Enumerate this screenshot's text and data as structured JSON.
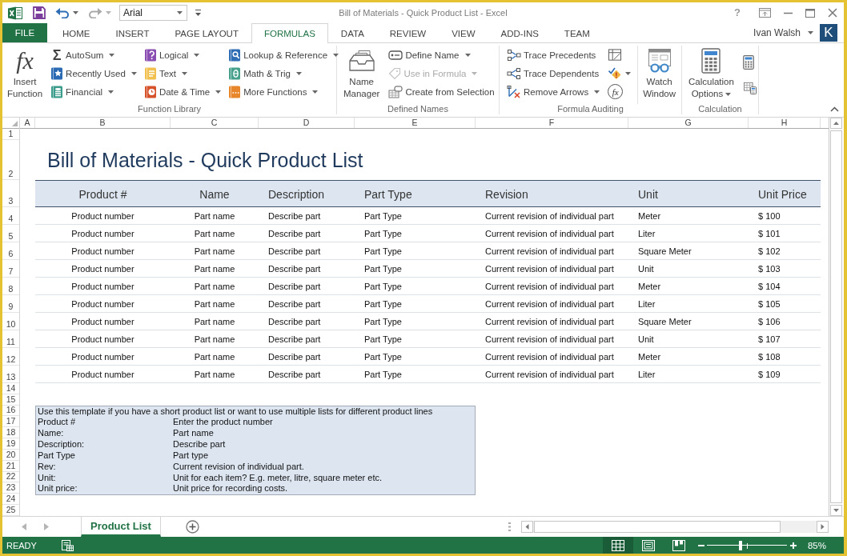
{
  "title_bar": {
    "font_name": "Arial",
    "title": "Bill of Materials - Quick Product List - Excel",
    "help": "?"
  },
  "ribbon_tabs": [
    {
      "label": "FILE",
      "kind": "file",
      "selected": false
    },
    {
      "label": "HOME",
      "kind": "tab",
      "selected": false
    },
    {
      "label": "INSERT",
      "kind": "tab",
      "selected": false
    },
    {
      "label": "PAGE LAYOUT",
      "kind": "tab",
      "selected": false
    },
    {
      "label": "FORMULAS",
      "kind": "tab",
      "selected": true
    },
    {
      "label": "DATA",
      "kind": "tab",
      "selected": false
    },
    {
      "label": "REVIEW",
      "kind": "tab",
      "selected": false
    },
    {
      "label": "VIEW",
      "kind": "tab",
      "selected": false
    },
    {
      "label": "ADD-INS",
      "kind": "tab",
      "selected": false
    },
    {
      "label": "TEAM",
      "kind": "tab",
      "selected": false
    }
  ],
  "account": {
    "user": "Ivan Walsh",
    "avatar": "K"
  },
  "ribbon_groups": [
    {
      "label": "Function Library",
      "columns": [
        [
          {
            "kind": "large",
            "glyph": "fx",
            "label": "Insert Function",
            "dropdown": false,
            "disabled": false
          }
        ],
        [
          {
            "kind": "small",
            "glyph": "Σ",
            "label": "AutoSum",
            "dropdown": true,
            "disabled": false
          },
          {
            "kind": "small",
            "label": "Recently Used",
            "dropdown": true,
            "disabled": false
          },
          {
            "kind": "small",
            "label": "Financial",
            "dropdown": true,
            "disabled": false
          }
        ],
        [
          {
            "kind": "small",
            "label": "Logical",
            "dropdown": true,
            "disabled": false
          },
          {
            "kind": "small",
            "label": "Text",
            "dropdown": true,
            "disabled": false
          },
          {
            "kind": "small",
            "label": "Date & Time",
            "dropdown": true,
            "disabled": false
          }
        ],
        [
          {
            "kind": "small",
            "label": "Lookup & Reference",
            "dropdown": true,
            "disabled": false
          },
          {
            "kind": "small",
            "label": "Math & Trig",
            "dropdown": true,
            "disabled": false
          },
          {
            "kind": "small",
            "label": "More Functions",
            "dropdown": true,
            "disabled": false
          }
        ]
      ]
    },
    {
      "label": "Defined Names",
      "columns": [
        [
          {
            "kind": "large",
            "label": "Name Manager",
            "dropdown": false,
            "disabled": false
          }
        ],
        [
          {
            "kind": "small",
            "label": "Define Name",
            "dropdown": true,
            "disabled": false
          },
          {
            "kind": "small",
            "label": "Use in Formula",
            "dropdown": true,
            "disabled": true
          },
          {
            "kind": "small",
            "label": "Create from Selection",
            "dropdown": false,
            "disabled": false
          }
        ]
      ]
    },
    {
      "label": "Formula Auditing",
      "columns": [
        [
          {
            "kind": "small",
            "label": "Trace Precedents",
            "dropdown": false,
            "disabled": false
          },
          {
            "kind": "small",
            "label": "Trace Dependents",
            "dropdown": false,
            "disabled": false
          },
          {
            "kind": "small",
            "label": "Remove Arrows",
            "dropdown": true,
            "disabled": false
          }
        ],
        [
          {
            "kind": "icon",
            "dropdown": false,
            "disabled": false
          },
          {
            "kind": "icon",
            "dropdown": true,
            "disabled": false
          },
          {
            "kind": "icon",
            "glyph": "fx",
            "dropdown": false,
            "disabled": false
          }
        ],
        [
          {
            "kind": "large",
            "label": "Watch Window",
            "dropdown": false,
            "disabled": false
          }
        ]
      ]
    },
    {
      "label": "Calculation",
      "columns": [
        [
          {
            "kind": "large",
            "label": "Calculation Options",
            "dropdown": true,
            "disabled": false
          }
        ],
        [
          {
            "kind": "icon",
            "dropdown": false,
            "disabled": false
          },
          {
            "kind": "icon",
            "dropdown": false,
            "disabled": false
          }
        ]
      ]
    }
  ],
  "sheet": {
    "column_headers": [
      "A",
      "B",
      "C",
      "D",
      "E",
      "F",
      "G",
      "H"
    ],
    "row_numbers": [
      "1",
      "2",
      "3",
      "4",
      "5",
      "6",
      "7",
      "8",
      "9",
      "10",
      "11",
      "12",
      "13",
      "14",
      "15",
      "16",
      "17",
      "18",
      "19",
      "20",
      "21",
      "22",
      "23",
      "24",
      "25"
    ],
    "title": "Bill of Materials - Quick Product List",
    "table": {
      "columns": [
        "Product #",
        "Name",
        "Description",
        "Part Type",
        "Revision",
        "Unit",
        "Unit Price"
      ],
      "rows": [
        [
          "Product number",
          "Part name",
          "Describe part",
          "Part Type",
          "Current revision of individual part",
          "Meter",
          "$ 100"
        ],
        [
          "Product number",
          "Part name",
          "Describe part",
          "Part Type",
          "Current revision of individual part",
          "Liter",
          "$ 101"
        ],
        [
          "Product number",
          "Part name",
          "Describe part",
          "Part Type",
          "Current revision of individual part",
          "Square Meter",
          "$ 102"
        ],
        [
          "Product number",
          "Part name",
          "Describe part",
          "Part Type",
          "Current revision of individual part",
          "Unit",
          "$ 103"
        ],
        [
          "Product number",
          "Part name",
          "Describe part",
          "Part Type",
          "Current revision of individual part",
          "Meter",
          "$ 104"
        ],
        [
          "Product number",
          "Part name",
          "Describe part",
          "Part Type",
          "Current revision of individual part",
          "Liter",
          "$ 105"
        ],
        [
          "Product number",
          "Part name",
          "Describe part",
          "Part Type",
          "Current revision of individual part",
          "Square Meter",
          "$ 106"
        ],
        [
          "Product number",
          "Part name",
          "Describe part",
          "Part Type",
          "Current revision of individual part",
          "Unit",
          "$ 107"
        ],
        [
          "Product number",
          "Part name",
          "Describe part",
          "Part Type",
          "Current revision of individual part",
          "Meter",
          "$ 108"
        ],
        [
          "Product number",
          "Part name",
          "Describe part",
          "Part Type",
          "Current revision of individual part",
          "Liter",
          "$ 109"
        ]
      ]
    },
    "notes": {
      "heading": "Use this template if you have a short product list or want to use multiple lists for different product lines",
      "rows": [
        {
          "label": "Product #",
          "text": "Enter the product number"
        },
        {
          "label": "Name:",
          "text": "Part name"
        },
        {
          "label": "Description:",
          "text": "Describe part"
        },
        {
          "label": "Part Type",
          "text": "Part type"
        },
        {
          "label": "Rev:",
          "text": "Current revision of individual part."
        },
        {
          "label": "Unit:",
          "text": "Unit for each item? E.g. meter, litre, square meter etc."
        },
        {
          "label": "Unit price:",
          "text": "Unit price for recording costs."
        }
      ]
    }
  },
  "sheet_tabs": [
    {
      "label": "Product List",
      "selected": true
    }
  ],
  "status_bar": {
    "mode": "READY",
    "views": [
      {
        "selected": true
      },
      {
        "selected": false
      },
      {
        "selected": false
      }
    ],
    "zoom": {
      "level": 0.42,
      "reading": "85%"
    }
  }
}
